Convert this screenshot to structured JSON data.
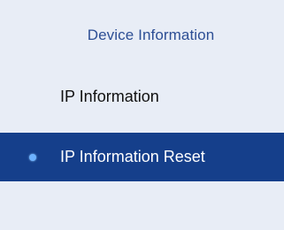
{
  "panel": {
    "header": "Device Information",
    "items": [
      {
        "label": "IP Information",
        "active": false
      },
      {
        "label": "IP Information Reset",
        "active": true
      }
    ]
  },
  "colors": {
    "panel_background": "#e8edf6",
    "header_text": "#2d4f95",
    "active_background": "#153f8b",
    "active_text": "#ffffff",
    "inactive_text": "#111111",
    "bullet": "#6db2ff"
  },
  "icons": {
    "active_marker": "bullet-dot-icon"
  }
}
